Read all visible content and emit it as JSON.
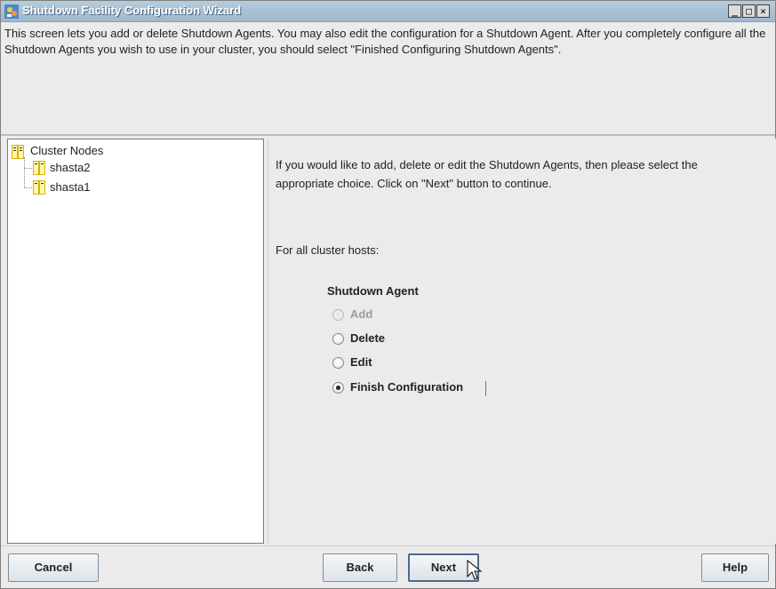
{
  "window": {
    "title": "Shutdown Facility Configuration Wizard",
    "controls": [
      "_",
      "□",
      "✕"
    ]
  },
  "info": {
    "text": "This screen lets you add or delete Shutdown Agents. You may also edit the configuration for a Shutdown Agent. After you completely configure all the Shutdown Agents you wish to use in your cluster, you should select \"Finished Configuring Shutdown Agents\"."
  },
  "tree": {
    "root": {
      "label": "Cluster Nodes",
      "icon": "cluster-nodes-icon"
    },
    "children": [
      {
        "label": "shasta2",
        "icon": "node-icon"
      },
      {
        "label": "shasta1",
        "icon": "node-icon"
      }
    ]
  },
  "main": {
    "prompt": "If you would like to add, delete or edit the Shutdown Agents, then please select the appropriate choice. Click on \"Next\" button to continue.",
    "hosts_label": "For all cluster hosts:",
    "group_label": "Shutdown Agent",
    "options": [
      {
        "label": "Add",
        "selected": false,
        "disabled": true
      },
      {
        "label": "Delete",
        "selected": false,
        "disabled": false
      },
      {
        "label": "Edit",
        "selected": false,
        "disabled": false
      },
      {
        "label": "Finish Configuration",
        "selected": true,
        "disabled": false
      }
    ]
  },
  "buttons": {
    "cancel": "Cancel",
    "back": "Back",
    "next": "Next",
    "help": "Help"
  },
  "colors": {
    "titlebar": "#9fb7cc",
    "panel": "#ebebeb",
    "button_border": "#7d8d9c"
  }
}
